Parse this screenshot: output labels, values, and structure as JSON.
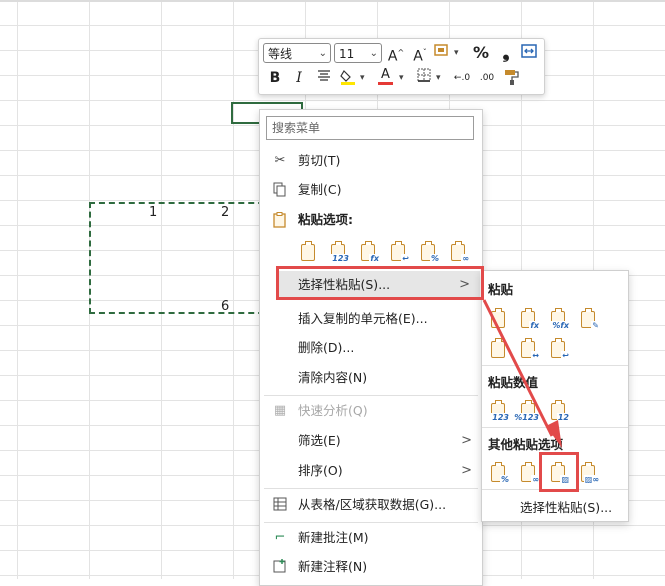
{
  "sheet": {
    "cells": [
      {
        "name": "cell-1",
        "text": "1"
      },
      {
        "name": "cell-2",
        "text": "2"
      },
      {
        "name": "cell-6",
        "text": "6"
      }
    ]
  },
  "mini_toolbar": {
    "font_name": "等线",
    "font_size": "11",
    "increase_font_icon": "A^",
    "decrease_font_icon": "A˅",
    "percent": "%",
    "comma": "❟",
    "bold": "B",
    "italic": "I",
    "font_color": "A",
    "decimal_increase": "←.0",
    "decimal_decrease": ".00",
    "accent_red": "#e53935",
    "highlight_yellow": "#ffe600"
  },
  "context_menu": {
    "search_placeholder": "搜索菜单",
    "cut": "剪切(T)",
    "copy": "复制(C)",
    "paste_options_header": "粘贴选项:",
    "paste_special": "选择性粘贴(S)...",
    "insert_copied": "插入复制的单元格(E)...",
    "delete": "删除(D)...",
    "clear_contents": "清除内容(N)",
    "quick_analysis": "快速分析(Q)",
    "filter": "筛选(E)",
    "sort": "排序(O)",
    "get_data": "从表格/区域获取数据(G)...",
    "new_comment": "新建批注(M)",
    "new_note": "新建注释(N)",
    "submenu_arrow": ">"
  },
  "submenu": {
    "paste_header": "粘贴",
    "paste_values_header": "粘贴数值",
    "other_header": "其他粘贴选项",
    "paste_special": "选择性粘贴(S)...",
    "value_badges": [
      "123",
      "%123",
      "12"
    ]
  },
  "annotations": {
    "highlight_color": "#e24a4a"
  }
}
